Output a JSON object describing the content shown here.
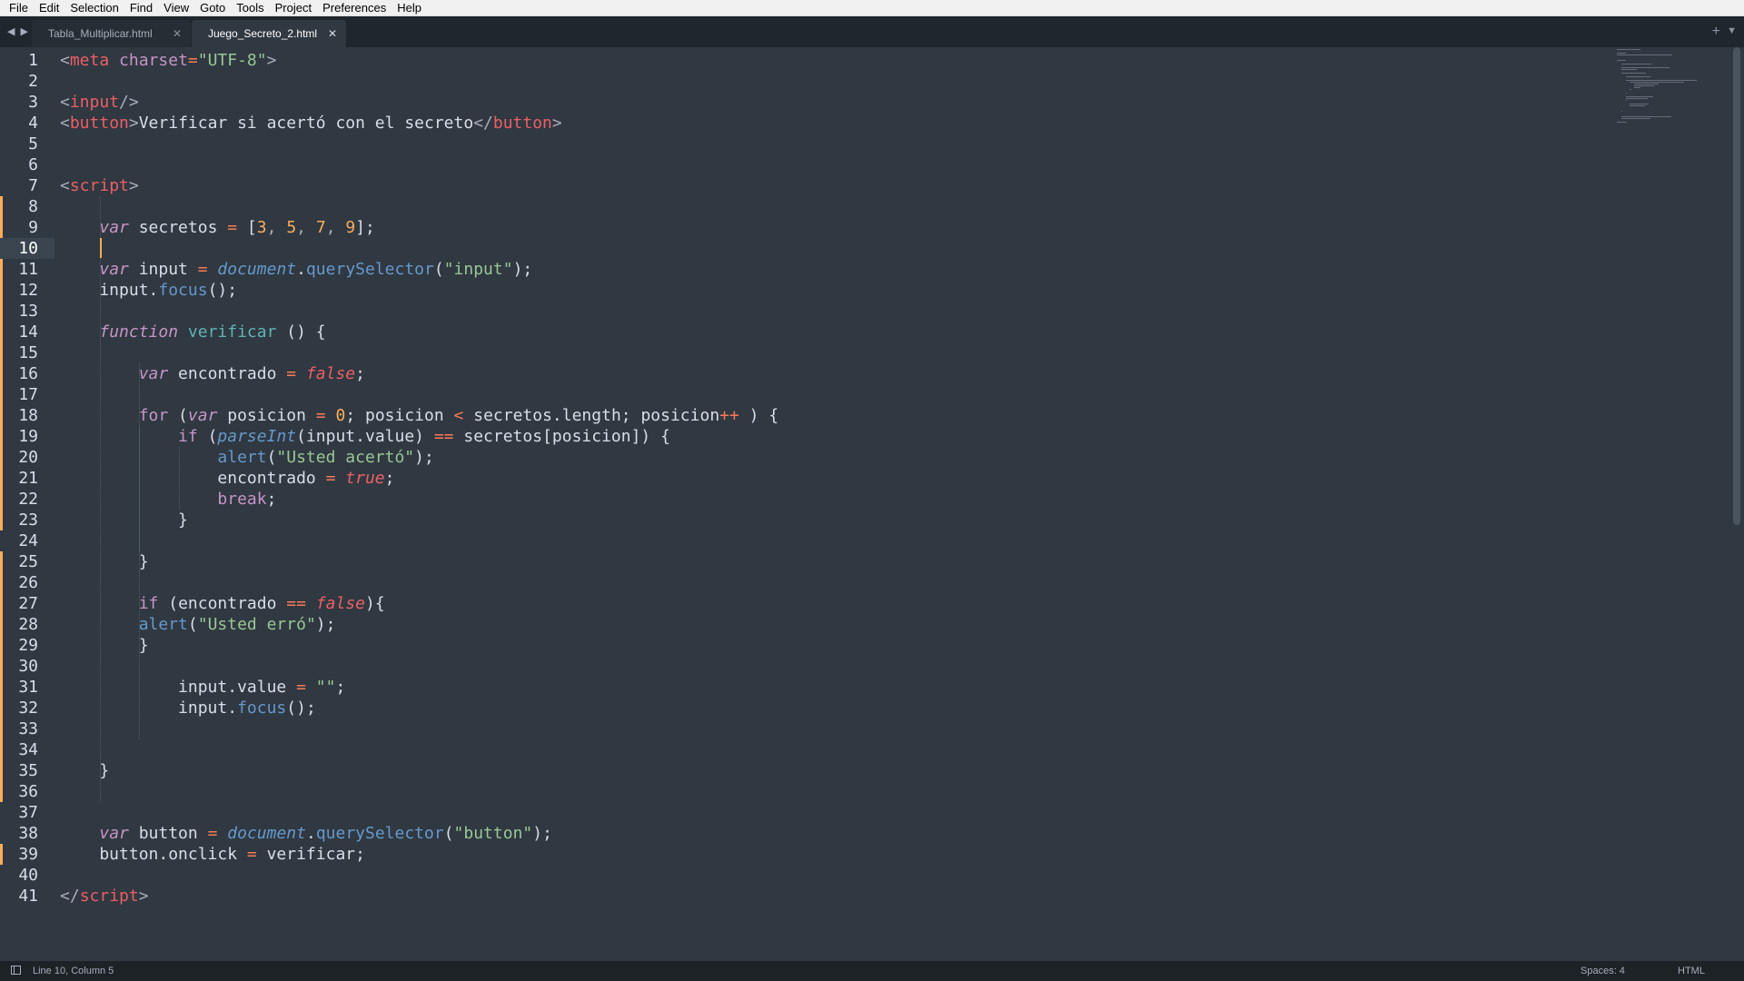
{
  "menu": [
    "File",
    "Edit",
    "Selection",
    "Find",
    "View",
    "Goto",
    "Tools",
    "Project",
    "Preferences",
    "Help"
  ],
  "tabs": [
    {
      "label": "Tabla_Multiplicar.html",
      "active": false
    },
    {
      "label": "Juego_Secreto_2.html",
      "active": true
    }
  ],
  "tab_controls": {
    "nav_icons": [
      "left-arrow-icon",
      "right-arrow-icon"
    ],
    "new_tab": "+",
    "menu": "▼"
  },
  "editor": {
    "current_line": 10,
    "modified_lines": [
      8,
      9,
      10,
      11,
      12,
      13,
      14,
      15,
      16,
      17,
      18,
      19,
      20,
      21,
      22,
      23,
      25,
      26,
      27,
      28,
      29,
      30,
      31,
      32,
      33,
      34,
      35,
      36,
      39
    ],
    "line_numbers": [
      "1",
      "2",
      "3",
      "4",
      "5",
      "6",
      "7",
      "8",
      "9",
      "10",
      "11",
      "12",
      "13",
      "14",
      "15",
      "16",
      "17",
      "18",
      "19",
      "20",
      "21",
      "22",
      "23",
      "24",
      "25",
      "26",
      "27",
      "28",
      "29",
      "30",
      "31",
      "32",
      "33",
      "34",
      "35",
      "36",
      "37",
      "38",
      "39",
      "40",
      "41"
    ],
    "lines": [
      [
        [
          "t-br",
          "<"
        ],
        [
          "t-tag",
          "meta"
        ],
        [
          "t-text",
          " "
        ],
        [
          "t-attr",
          "charset"
        ],
        [
          "t-op",
          "="
        ],
        [
          "t-str",
          "\"UTF-8\""
        ],
        [
          "t-br",
          ">"
        ]
      ],
      [],
      [
        [
          "t-br",
          "<"
        ],
        [
          "t-tag",
          "input"
        ],
        [
          "t-br",
          "/>"
        ]
      ],
      [
        [
          "t-br",
          "<"
        ],
        [
          "t-tag",
          "button"
        ],
        [
          "t-br",
          ">"
        ],
        [
          "t-text",
          "Verificar si acertó con el secreto"
        ],
        [
          "t-br",
          "</"
        ],
        [
          "t-tag",
          "button"
        ],
        [
          "t-br",
          ">"
        ]
      ],
      [],
      [],
      [
        [
          "t-br",
          "<"
        ],
        [
          "t-tag",
          "script"
        ],
        [
          "t-br",
          ">"
        ]
      ],
      [],
      [
        [
          "t-text",
          "    "
        ],
        [
          "t-kw",
          "var"
        ],
        [
          "t-text",
          " secretos "
        ],
        [
          "t-op",
          "="
        ],
        [
          "t-text",
          " ["
        ],
        [
          "t-num",
          "3"
        ],
        [
          "t-comma",
          ", "
        ],
        [
          "t-num",
          "5"
        ],
        [
          "t-comma",
          ", "
        ],
        [
          "t-num",
          "7"
        ],
        [
          "t-comma",
          ", "
        ],
        [
          "t-num",
          "9"
        ],
        [
          "t-text",
          "];"
        ]
      ],
      [],
      [
        [
          "t-text",
          "    "
        ],
        [
          "t-kw",
          "var"
        ],
        [
          "t-text",
          " input "
        ],
        [
          "t-op",
          "="
        ],
        [
          "t-text",
          " "
        ],
        [
          "t-obj",
          "document"
        ],
        [
          "t-text",
          "."
        ],
        [
          "t-call",
          "querySelector"
        ],
        [
          "t-text",
          "("
        ],
        [
          "t-str",
          "\"input\""
        ],
        [
          "t-text",
          ");"
        ]
      ],
      [
        [
          "t-text",
          "    input."
        ],
        [
          "t-call",
          "focus"
        ],
        [
          "t-text",
          "();"
        ]
      ],
      [],
      [
        [
          "t-text",
          "    "
        ],
        [
          "t-kw",
          "function"
        ],
        [
          "t-text",
          " "
        ],
        [
          "t-fn",
          "verificar"
        ],
        [
          "t-text",
          " () {"
        ]
      ],
      [],
      [
        [
          "t-text",
          "        "
        ],
        [
          "t-kw",
          "var"
        ],
        [
          "t-text",
          " encontrado "
        ],
        [
          "t-op",
          "="
        ],
        [
          "t-text",
          " "
        ],
        [
          "t-bool",
          "false"
        ],
        [
          "t-text",
          ";"
        ]
      ],
      [],
      [
        [
          "t-text",
          "        "
        ],
        [
          "t-kw2",
          "for"
        ],
        [
          "t-text",
          " ("
        ],
        [
          "t-kw",
          "var"
        ],
        [
          "t-text",
          " posicion "
        ],
        [
          "t-op",
          "="
        ],
        [
          "t-text",
          " "
        ],
        [
          "t-num",
          "0"
        ],
        [
          "t-text",
          "; posicion "
        ],
        [
          "t-op",
          "<"
        ],
        [
          "t-text",
          " secretos.length; posicion"
        ],
        [
          "t-op",
          "++"
        ],
        [
          "t-text",
          " ) {"
        ]
      ],
      [
        [
          "t-text",
          "            "
        ],
        [
          "t-kw2",
          "if"
        ],
        [
          "t-text",
          " ("
        ],
        [
          "t-obj",
          "parseInt"
        ],
        [
          "t-text",
          "(input.value) "
        ],
        [
          "t-op",
          "=="
        ],
        [
          "t-text",
          " secretos[posicion]) {"
        ]
      ],
      [
        [
          "t-text",
          "                "
        ],
        [
          "t-call",
          "alert"
        ],
        [
          "t-text",
          "("
        ],
        [
          "t-str",
          "\"Usted acertó\""
        ],
        [
          "t-text",
          ");"
        ]
      ],
      [
        [
          "t-text",
          "                encontrado "
        ],
        [
          "t-op",
          "="
        ],
        [
          "t-text",
          " "
        ],
        [
          "t-bool",
          "true"
        ],
        [
          "t-text",
          ";"
        ]
      ],
      [
        [
          "t-text",
          "                "
        ],
        [
          "t-kw2",
          "break"
        ],
        [
          "t-text",
          ";"
        ]
      ],
      [
        [
          "t-text",
          "            }"
        ]
      ],
      [],
      [
        [
          "t-text",
          "        }"
        ]
      ],
      [],
      [
        [
          "t-text",
          "        "
        ],
        [
          "t-kw2",
          "if"
        ],
        [
          "t-text",
          " (encontrado "
        ],
        [
          "t-op",
          "=="
        ],
        [
          "t-text",
          " "
        ],
        [
          "t-bool",
          "false"
        ],
        [
          "t-text",
          "){"
        ]
      ],
      [
        [
          "t-text",
          "        "
        ],
        [
          "t-call",
          "alert"
        ],
        [
          "t-text",
          "("
        ],
        [
          "t-str",
          "\"Usted erró\""
        ],
        [
          "t-text",
          ");"
        ]
      ],
      [
        [
          "t-text",
          "        }"
        ]
      ],
      [],
      [
        [
          "t-text",
          "            input.value "
        ],
        [
          "t-op",
          "="
        ],
        [
          "t-text",
          " "
        ],
        [
          "t-str",
          "\"\""
        ],
        [
          "t-text",
          ";"
        ]
      ],
      [
        [
          "t-text",
          "            input."
        ],
        [
          "t-call",
          "focus"
        ],
        [
          "t-text",
          "();"
        ]
      ],
      [],
      [],
      [
        [
          "t-text",
          "    }"
        ]
      ],
      [],
      [],
      [
        [
          "t-text",
          "    "
        ],
        [
          "t-kw",
          "var"
        ],
        [
          "t-text",
          " button "
        ],
        [
          "t-op",
          "="
        ],
        [
          "t-text",
          " "
        ],
        [
          "t-obj",
          "document"
        ],
        [
          "t-text",
          "."
        ],
        [
          "t-call",
          "querySelector"
        ],
        [
          "t-text",
          "("
        ],
        [
          "t-str",
          "\"button\""
        ],
        [
          "t-text",
          ");"
        ]
      ],
      [
        [
          "t-text",
          "    button.onclick "
        ],
        [
          "t-op",
          "="
        ],
        [
          "t-text",
          " verificar;"
        ]
      ],
      [],
      [
        [
          "t-br",
          "</"
        ],
        [
          "t-tag",
          "script"
        ],
        [
          "t-br",
          ">"
        ]
      ]
    ]
  },
  "status": {
    "position": "Line 10, Column 5",
    "indent": "Spaces: 4",
    "syntax": "HTML"
  },
  "colors": {
    "background": "#303841",
    "gutter_current": "#3b4550",
    "modified_marker": "#f9ae58",
    "tag": "#ec5f66",
    "string": "#99c794",
    "keyword": "#c695c6",
    "number": "#f9ae58",
    "function": "#5fb4b4",
    "call": "#6699cc"
  }
}
